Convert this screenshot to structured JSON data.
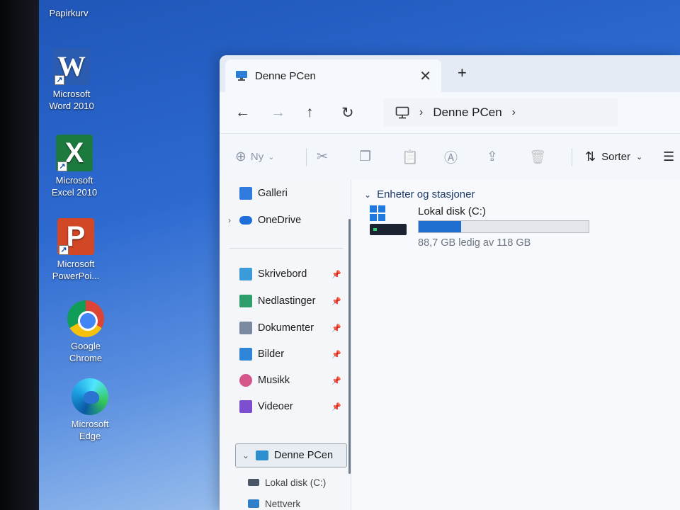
{
  "desktop": {
    "top_label": "Papirkurv",
    "icons": [
      {
        "letter": "W",
        "label_line1": "Microsoft",
        "label_line2": "Word 2010"
      },
      {
        "letter": "X",
        "label_line1": "Microsoft",
        "label_line2": "Excel 2010"
      },
      {
        "letter": "P",
        "label_line1": "Microsoft",
        "label_line2": "PowerPoi..."
      },
      {
        "letter": "",
        "label_line1": "Google",
        "label_line2": "Chrome"
      },
      {
        "letter": "",
        "label_line1": "Microsoft",
        "label_line2": "Edge"
      }
    ]
  },
  "explorer": {
    "tab_title": "Denne PCen",
    "close_glyph": "✕",
    "new_tab_glyph": "+",
    "nav": {
      "back": "←",
      "forward": "→",
      "up": "↑",
      "refresh": "↻"
    },
    "breadcrumb": {
      "root_icon": "monitor-icon",
      "chevron": "›",
      "location": "Denne PCen",
      "trailing": "›"
    },
    "commands": {
      "new_label": "Ny",
      "new_icon": "⊕",
      "cut": "✂",
      "copy": "❐",
      "paste": "📋",
      "rename": "Ⓐ",
      "share": "⇪",
      "delete": "🗑",
      "sort_label": "Sorter",
      "sort_icon": "⇅",
      "chevron": "⌄",
      "view_icon": "☰"
    },
    "sidebar": {
      "top_items": [
        {
          "label": "Galleri",
          "color": "#2f7be0"
        },
        {
          "label": "OneDrive",
          "color": "#1e6fd9",
          "expandable": true
        }
      ],
      "quick_access": [
        {
          "label": "Skrivebord",
          "color": "#3a9bd8"
        },
        {
          "label": "Nedlastinger",
          "color": "#2e9e6a"
        },
        {
          "label": "Dokumenter",
          "color": "#7a8aa0"
        },
        {
          "label": "Bilder",
          "color": "#2f86d8"
        },
        {
          "label": "Musikk",
          "color": "#d5568a"
        },
        {
          "label": "Videoer",
          "color": "#7d4fd0"
        }
      ],
      "pin_glyph": "📌",
      "expand_glyph": "›",
      "collapse_glyph": "⌄",
      "tree": [
        {
          "label": "Denne PCen",
          "selected": true
        },
        {
          "label": "Lokal disk (C:)"
        },
        {
          "label": "Nettverk"
        }
      ]
    },
    "content": {
      "section_title": "Enheter og stasjoner",
      "drive": {
        "name": "Lokal disk (C:)",
        "free_text": "88,7 GB ledig av 118 GB",
        "used_fraction": 0.248,
        "bar_color": "#1f6fd1"
      }
    }
  }
}
